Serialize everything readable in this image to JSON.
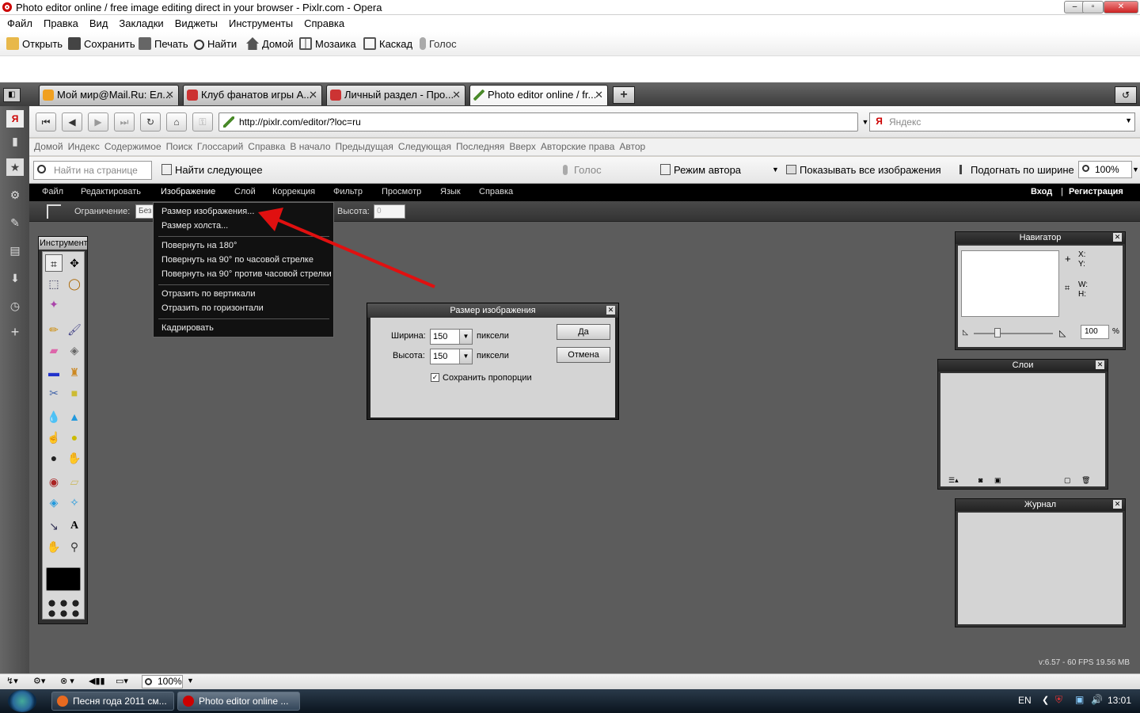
{
  "window": {
    "title": "Photo editor online / free image editing direct in your browser - Pixlr.com - Opera",
    "minimize": "‒",
    "maximize": "▫",
    "close": "✕"
  },
  "menubar": [
    "Файл",
    "Правка",
    "Вид",
    "Закладки",
    "Виджеты",
    "Инструменты",
    "Справка"
  ],
  "toolbar": [
    "Открыть",
    "Сохранить",
    "Печать",
    "Найти",
    "Домой",
    "Мозаика",
    "Каскад",
    "Голос"
  ],
  "tabs": [
    {
      "label": "Мой мир@Mail.Ru: Ел...",
      "close": "✕"
    },
    {
      "label": "Клуб фанатов игры А...",
      "close": "✕"
    },
    {
      "label": "Личный раздел - Про...",
      "close": "✕"
    },
    {
      "label": "Photo editor online / fr...",
      "close": "✕"
    }
  ],
  "address": {
    "url": "http://pixlr.com/editor/?loc=ru",
    "search_placeholder": "Яндекс"
  },
  "links": [
    "Домой",
    "Индекс",
    "Содержимое",
    "Поиск",
    "Глоссарий",
    "Справка",
    "В начало",
    "Предыдущая",
    "Следующая",
    "Последняя",
    "Вверх",
    "Авторские права",
    "Автор"
  ],
  "findbar": {
    "placeholder": "Найти на странице",
    "find_next": "Найти следующее",
    "voice": "Голос",
    "author_mode": "Режим автора",
    "show_images": "Показывать все изображения",
    "fit_width": "Подогнать по ширине",
    "zoom": "100%"
  },
  "pixlr": {
    "menu": [
      "Файл",
      "Редактировать",
      "Изображение",
      "Слой",
      "Коррекция",
      "Фильтр",
      "Просмотр",
      "Язык",
      "Справка"
    ],
    "login": "Вход",
    "divider": "|",
    "register": "Регистрация",
    "options": {
      "limit_label": "Ограничение:",
      "limit_value": "Без",
      "width_value": "0",
      "height_label": "Высота:",
      "height_value": "0"
    },
    "tools_title": "Инструменты",
    "dropdown": [
      "Размер изображения...",
      "Размер холста...",
      "Повернуть на 180°",
      "Повернуть на 90° по часовой стрелке",
      "Повернуть на 90° против часовой стрелки",
      "Отразить по вертикали",
      "Отразить по горизонтали",
      "Кадрировать"
    ],
    "dialog": {
      "title": "Размер изображения",
      "width_label": "Ширина:",
      "width_value": "150",
      "height_label": "Высота:",
      "height_value": "150",
      "unit": "пиксели",
      "ok": "Да",
      "cancel": "Отмена",
      "keep_ratio": "Сохранить пропорции",
      "keep_ratio_checked": true
    },
    "navigator": {
      "title": "Навигатор",
      "x": "X:",
      "y": "Y:",
      "w": "W:",
      "h": "H:",
      "zoom": "100",
      "percent": "%",
      "zoom_slider_fraction": 0.3
    },
    "layers": {
      "title": "Слои"
    },
    "history": {
      "title": "Журнал"
    },
    "version": "v:6.57 - 60 FPS 19.56 MB"
  },
  "statusbar": {
    "zoom": "100%"
  },
  "taskbar": {
    "tasks": [
      "Песня года 2011 см...",
      "Photo editor online ..."
    ],
    "lang": "EN",
    "time": "13:01"
  },
  "colors": {
    "pixlr_bg": "#5c5c5c",
    "pixlr_menu": "#000000",
    "arrow": "#e01010"
  }
}
